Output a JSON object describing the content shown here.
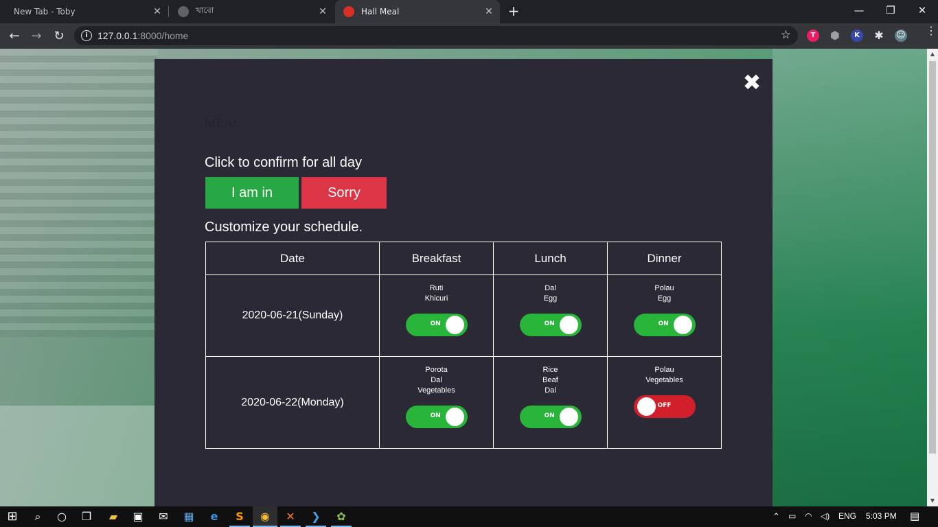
{
  "browser": {
    "tabs": [
      {
        "title": "New Tab - Toby",
        "favicon_color": "#202124",
        "active": false
      },
      {
        "title": "খাবো",
        "favicon_color": "#5f6368",
        "active": false
      },
      {
        "title": "Hall Meal",
        "favicon_color": "#d93025",
        "active": true
      }
    ],
    "tab_close_glyph": "✕",
    "new_tab_glyph": "+",
    "window_controls": {
      "minimize": "—",
      "restore": "❐",
      "close": "✕"
    },
    "nav": {
      "back": "←",
      "forward": "→",
      "reload": "↻"
    },
    "address": {
      "host": "127.0.0.1",
      "path": ":8000/home",
      "info_glyph": "i",
      "star_glyph": "☆"
    },
    "extensions": [
      {
        "name": "toby-extension-icon",
        "glyph": "T",
        "color": "#e91e63"
      },
      {
        "name": "shield-extension-icon",
        "glyph": "⬢",
        "color": "#9aa0a6"
      },
      {
        "name": "k-extension-icon",
        "glyph": "K",
        "color": "#3949ab"
      },
      {
        "name": "puzzle-extension-icon",
        "glyph": "✱",
        "color": "#5f6368"
      },
      {
        "name": "profile-avatar-icon",
        "glyph": "☺",
        "color": "#607d8b"
      }
    ],
    "menu_glyph": "⋮"
  },
  "modal": {
    "close_glyph": "✖",
    "heading": "MEAL",
    "confirm_label": "Click to confirm for all day",
    "btn_in": "I am in",
    "btn_sorry": "Sorry",
    "customize_label": "Customize your schedule.",
    "columns": [
      "Date",
      "Breakfast",
      "Lunch",
      "Dinner"
    ],
    "rows": [
      {
        "date": "2020-06-21(Sunday)",
        "breakfast": {
          "items": [
            "Ruti",
            "Khicuri"
          ],
          "state": "ON"
        },
        "lunch": {
          "items": [
            "Dal",
            "Egg"
          ],
          "state": "ON"
        },
        "dinner": {
          "items": [
            "Polau",
            "Egg"
          ],
          "state": "ON"
        }
      },
      {
        "date": "2020-06-22(Monday)",
        "breakfast": {
          "items": [
            "Porota",
            "Dal",
            "Vegetables"
          ],
          "state": "ON"
        },
        "lunch": {
          "items": [
            "Rice",
            "Beaf",
            "Dal"
          ],
          "state": "ON"
        },
        "dinner": {
          "items": [
            "Polau",
            "Vegetables"
          ],
          "state": "OFF"
        }
      }
    ]
  },
  "taskbar": {
    "start_glyph": "⊞",
    "search_glyph": "⌕",
    "cortana_glyph": "○",
    "taskview_glyph": "❐",
    "apps": [
      {
        "name": "file-explorer-icon",
        "glyph": "▰",
        "color": "#f3c140"
      },
      {
        "name": "store-icon",
        "glyph": "▣",
        "color": "#ffffff"
      },
      {
        "name": "mail-icon",
        "glyph": "✉",
        "color": "#ffffff"
      },
      {
        "name": "app-icon",
        "glyph": "▦",
        "color": "#5ea9e6"
      },
      {
        "name": "edge-icon",
        "glyph": "e",
        "color": "#3a96dd"
      },
      {
        "name": "sublime-icon",
        "glyph": "S",
        "color": "#ff9800"
      },
      {
        "name": "chrome-icon",
        "glyph": "◉",
        "color": "#fbc02d"
      },
      {
        "name": "xampp-icon",
        "glyph": "✕",
        "color": "#fb7a24"
      },
      {
        "name": "powershell-icon",
        "glyph": "❯",
        "color": "#4aa1e8"
      },
      {
        "name": "paint-icon",
        "glyph": "✿",
        "color": "#8bc34a"
      }
    ],
    "tray": {
      "chevron": "⌃",
      "language": "ENG",
      "time": "5:03 PM",
      "notification_glyph": "▤"
    }
  }
}
